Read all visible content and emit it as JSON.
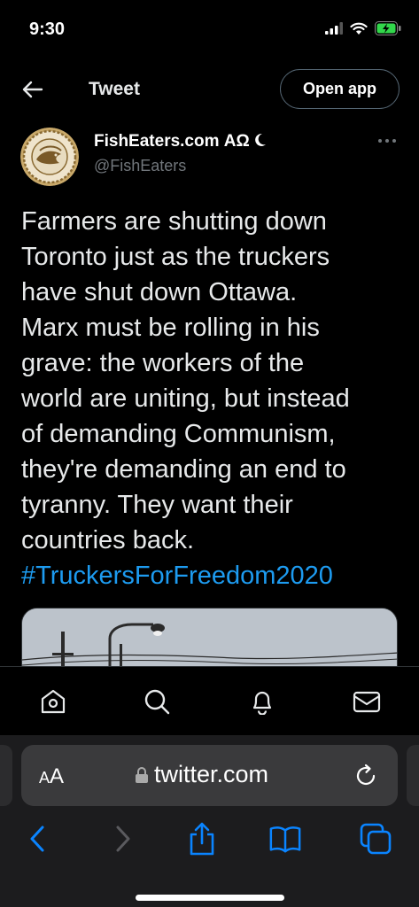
{
  "status_bar": {
    "time": "9:30"
  },
  "header": {
    "title": "Tweet",
    "open_app_label": "Open app"
  },
  "tweet": {
    "author_name": "FishEaters.com ΑΩ",
    "author_handle": "@FishEaters",
    "text_lines": [
      "Farmers are shutting down",
      "Toronto just as the truckers",
      "have shut down Ottawa.",
      "Marx must be rolling in his",
      "grave: the workers of the",
      "world are uniting, but instead",
      "of demanding Communism,",
      "they're demanding an end to",
      "tyranny. They want their",
      "countries back."
    ],
    "hashtag": "#TruckersForFreedom2020"
  },
  "tabbar": {
    "items": [
      "home-icon",
      "search-icon",
      "bell-icon",
      "mail-icon"
    ]
  },
  "safari": {
    "aa_label_small": "A",
    "aa_label_big": "A",
    "url": "twitter.com"
  },
  "colors": {
    "background": "#000000",
    "link": "#1d9bf0",
    "safari_blue": "#0a84ff",
    "muted": "#71767b"
  }
}
